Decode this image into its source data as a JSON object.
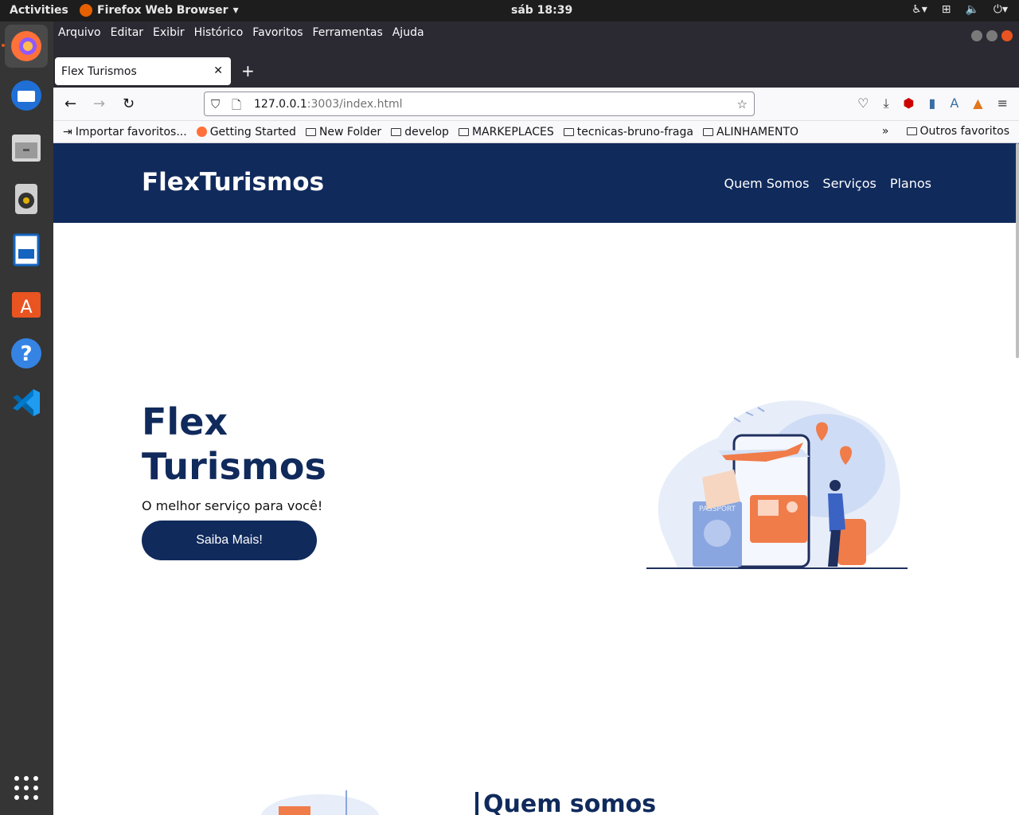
{
  "system": {
    "activities": "Activities",
    "app_name": "Firefox Web Browser",
    "clock": "sáb 18:39"
  },
  "browser": {
    "menu": [
      "Arquivo",
      "Editar",
      "Exibir",
      "Histórico",
      "Favoritos",
      "Ferramentas",
      "Ajuda"
    ],
    "tab_title": "Flex Turismos",
    "url_host": "127.0.0.1",
    "url_rest": ":3003/index.html",
    "bookmarks": [
      "Importar favoritos...",
      "Getting Started",
      "New Folder",
      "develop",
      "MARKEPLACES",
      "tecnicas-bruno-fraga",
      "ALINHAMENTO"
    ],
    "other_bookmarks": "Outros favoritos"
  },
  "site": {
    "logo": "FlexTurismos",
    "nav": [
      "Quem Somos",
      "Serviços",
      "Planos"
    ],
    "hero_title_line1": "Flex",
    "hero_title_line2": "Turismos",
    "hero_subtitle": "O melhor serviço para você!",
    "hero_button": "Saiba Mais!",
    "about_title": "Quem somos",
    "passport_label": "PASSPORT"
  },
  "colors": {
    "brand_navy": "#102a5c",
    "accent_orange": "#f07c4a"
  }
}
